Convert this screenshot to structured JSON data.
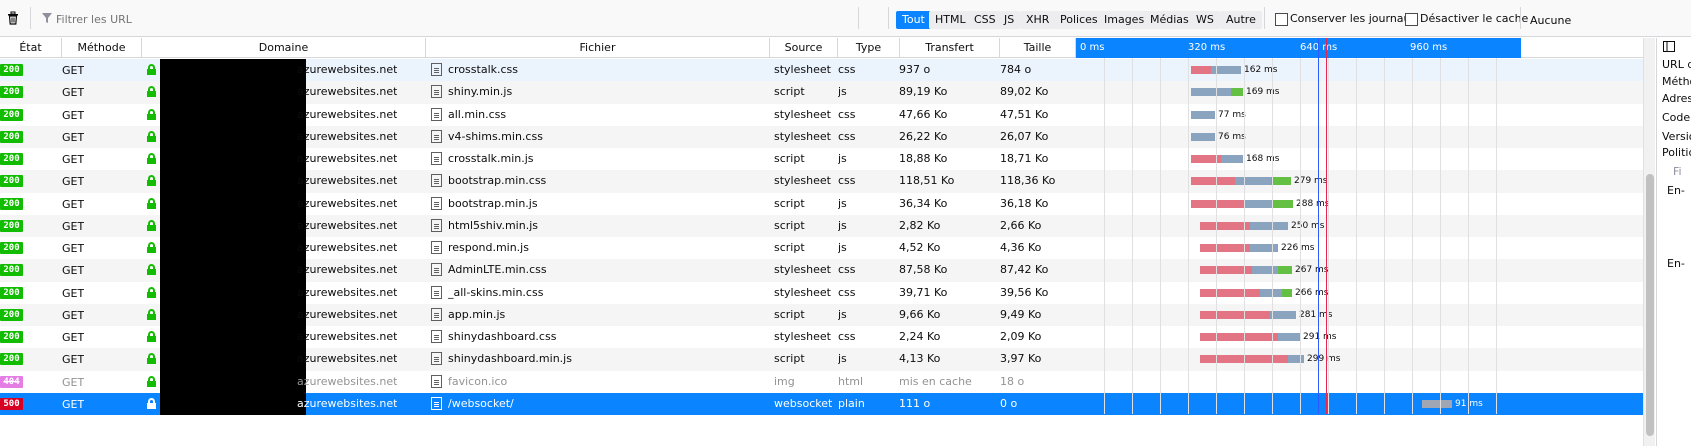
{
  "toolbar": {
    "filter_placeholder": "Filtrer les URL",
    "pause_glyph": "||",
    "types": [
      {
        "label": "Tout",
        "active": true
      },
      {
        "label": "HTML",
        "active": false
      },
      {
        "label": "CSS",
        "active": false
      },
      {
        "label": "JS",
        "active": false
      },
      {
        "label": "XHR",
        "active": false
      },
      {
        "label": "Polices",
        "active": false
      },
      {
        "label": "Images",
        "active": false
      },
      {
        "label": "Médias",
        "active": false
      },
      {
        "label": "WS",
        "active": false
      },
      {
        "label": "Autre",
        "active": false
      }
    ],
    "persist_logs": "Conserver les journaux",
    "disable_cache": "Désactiver le cache",
    "throttle": "Aucune"
  },
  "columns": {
    "status": "État",
    "method": "Méthode",
    "domain": "Domaine",
    "file": "Fichier",
    "cause": "Source",
    "type": "Type",
    "transferred": "Transfert",
    "size": "Taille"
  },
  "waterfall_ticks": [
    "0 ms",
    "320 ms",
    "640 ms",
    "960 ms"
  ],
  "requests": [
    {
      "status": "200",
      "method": "GET",
      "domain": "azurewebsites.net",
      "file": "crosstalk.css",
      "cause": "stylesheet",
      "type": "css",
      "transferred": "937 o",
      "size": "784 o",
      "timing": "162 ms",
      "start": 1191,
      "segs": [
        [
          "#e37484",
          20
        ],
        [
          "#8aa4c0",
          30
        ]
      ]
    },
    {
      "status": "200",
      "method": "GET",
      "domain": "azurewebsites.net",
      "file": "shiny.min.js",
      "cause": "script",
      "type": "js",
      "transferred": "89,19 Ko",
      "size": "89,02 Ko",
      "timing": "169 ms",
      "start": 1191,
      "segs": [
        [
          "#8aa4c0",
          40
        ],
        [
          "#63c043",
          12
        ]
      ]
    },
    {
      "status": "200",
      "method": "GET",
      "domain": "azurewebsites.net",
      "file": "all.min.css",
      "cause": "stylesheet",
      "type": "css",
      "transferred": "47,66 Ko",
      "size": "47,51 Ko",
      "timing": "77 ms",
      "start": 1191,
      "segs": [
        [
          "#8aa4c0",
          24
        ]
      ]
    },
    {
      "status": "200",
      "method": "GET",
      "domain": "azurewebsites.net",
      "file": "v4-shims.min.css",
      "cause": "stylesheet",
      "type": "css",
      "transferred": "26,22 Ko",
      "size": "26,07 Ko",
      "timing": "76 ms",
      "start": 1191,
      "segs": [
        [
          "#8aa4c0",
          24
        ]
      ]
    },
    {
      "status": "200",
      "method": "GET",
      "domain": "azurewebsites.net",
      "file": "crosstalk.min.js",
      "cause": "script",
      "type": "js",
      "transferred": "18,88 Ko",
      "size": "18,71 Ko",
      "timing": "168 ms",
      "start": 1191,
      "segs": [
        [
          "#e37484",
          30
        ],
        [
          "#8aa4c0",
          22
        ]
      ]
    },
    {
      "status": "200",
      "method": "GET",
      "domain": "azurewebsites.net",
      "file": "bootstrap.min.css",
      "cause": "stylesheet",
      "type": "css",
      "transferred": "118,51 Ko",
      "size": "118,36 Ko",
      "timing": "279 ms",
      "start": 1191,
      "segs": [
        [
          "#e37484",
          44
        ],
        [
          "#8aa4c0",
          36
        ],
        [
          "#63c043",
          20
        ]
      ]
    },
    {
      "status": "200",
      "method": "GET",
      "domain": "azurewebsites.net",
      "file": "bootstrap.min.js",
      "cause": "script",
      "type": "js",
      "transferred": "36,34 Ko",
      "size": "36,18 Ko",
      "timing": "288 ms",
      "start": 1191,
      "segs": [
        [
          "#e37484",
          54
        ],
        [
          "#8aa4c0",
          28
        ],
        [
          "#63c043",
          20
        ]
      ]
    },
    {
      "status": "200",
      "method": "GET",
      "domain": "azurewebsites.net",
      "file": "html5shiv.min.js",
      "cause": "script",
      "type": "js",
      "transferred": "2,82 Ko",
      "size": "2,66 Ko",
      "timing": "250 ms",
      "start": 1200,
      "segs": [
        [
          "#e37484",
          50
        ],
        [
          "#8aa4c0",
          38
        ]
      ]
    },
    {
      "status": "200",
      "method": "GET",
      "domain": "azurewebsites.net",
      "file": "respond.min.js",
      "cause": "script",
      "type": "js",
      "transferred": "4,52 Ko",
      "size": "4,36 Ko",
      "timing": "226 ms",
      "start": 1200,
      "segs": [
        [
          "#e37484",
          50
        ],
        [
          "#8aa4c0",
          28
        ]
      ]
    },
    {
      "status": "200",
      "method": "GET",
      "domain": "azurewebsites.net",
      "file": "AdminLTE.min.css",
      "cause": "stylesheet",
      "type": "css",
      "transferred": "87,58 Ko",
      "size": "87,42 Ko",
      "timing": "267 ms",
      "start": 1200,
      "segs": [
        [
          "#e37484",
          52
        ],
        [
          "#8aa4c0",
          26
        ],
        [
          "#63c043",
          14
        ]
      ]
    },
    {
      "status": "200",
      "method": "GET",
      "domain": "azurewebsites.net",
      "file": "_all-skins.min.css",
      "cause": "stylesheet",
      "type": "css",
      "transferred": "39,71 Ko",
      "size": "39,56 Ko",
      "timing": "266 ms",
      "start": 1200,
      "segs": [
        [
          "#e37484",
          60
        ],
        [
          "#8aa4c0",
          22
        ],
        [
          "#63c043",
          10
        ]
      ]
    },
    {
      "status": "200",
      "method": "GET",
      "domain": "azurewebsites.net",
      "file": "app.min.js",
      "cause": "script",
      "type": "js",
      "transferred": "9,66 Ko",
      "size": "9,49 Ko",
      "timing": "281 ms",
      "start": 1200,
      "segs": [
        [
          "#e37484",
          70
        ],
        [
          "#8aa4c0",
          26
        ]
      ]
    },
    {
      "status": "200",
      "method": "GET",
      "domain": "azurewebsites.net",
      "file": "shinydashboard.css",
      "cause": "stylesheet",
      "type": "css",
      "transferred": "2,24 Ko",
      "size": "2,09 Ko",
      "timing": "291 ms",
      "start": 1200,
      "segs": [
        [
          "#e37484",
          78
        ],
        [
          "#8aa4c0",
          22
        ]
      ]
    },
    {
      "status": "200",
      "method": "GET",
      "domain": "azurewebsites.net",
      "file": "shinydashboard.min.js",
      "cause": "script",
      "type": "js",
      "transferred": "4,13 Ko",
      "size": "3,97 Ko",
      "timing": "299 ms",
      "start": 1200,
      "segs": [
        [
          "#e37484",
          88
        ],
        [
          "#8aa4c0",
          16
        ]
      ]
    },
    {
      "status": "404",
      "method": "GET",
      "domain": "azurewebsites.net",
      "file": "favicon.ico",
      "cause": "img",
      "type": "html",
      "transferred": "mis en cache",
      "size": "18 o",
      "timing": "",
      "start": 0,
      "segs": []
    },
    {
      "status": "500",
      "method": "GET",
      "domain": "azurewebsites.net",
      "file": "/websocket/",
      "cause": "websocket",
      "type": "plain",
      "transferred": "111 o",
      "size": "0 o",
      "timing": "91 ms",
      "start": 1422,
      "segs": [
        [
          "#a0a6b4",
          30
        ]
      ]
    }
  ],
  "sidepanel": {
    "items": [
      "URL d",
      "Métho",
      "Adres",
      "Code",
      "Versio",
      "Politic",
      "Fi",
      "En-",
      "En-"
    ]
  },
  "colors": {
    "accent": "#0a84ff",
    "status_ok": "#12bc00",
    "status_404": "#e47ee4",
    "status_500": "#d70022",
    "blocked": "#e37484",
    "waiting": "#8aa4c0",
    "receiving": "#63c043"
  }
}
